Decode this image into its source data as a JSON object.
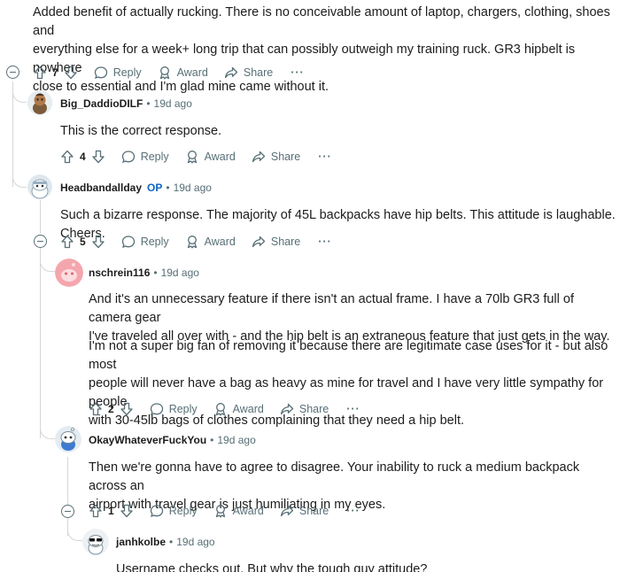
{
  "comments": [
    {
      "body": [
        "Added benefit of actually rucking. There is no conceivable amount of laptop, chargers, clothing, shoes and",
        "everything else for a week+ long trip that can possibly outweigh my training ruck. GR3 hipbelt is nowhere",
        "close to essential and I'm glad mine came without it."
      ],
      "votes": "7"
    },
    {
      "user": "Big_DaddioDILF",
      "time": "19d ago",
      "body": [
        "This is the correct response."
      ],
      "votes": "4"
    },
    {
      "user": "Headbandallday",
      "op": "OP",
      "time": "19d ago",
      "body": [
        "Such a bizarre response. The majority of 45L backpacks have hip belts. This attitude is laughable. Cheers."
      ],
      "votes": "5"
    },
    {
      "user": "nschrein116",
      "time": "19d ago",
      "body": [
        "And it's an unnecessary feature if there isn't an actual frame. I have a 70lb GR3 full of camera gear",
        "I've traveled all over with - and the hip belt is an extraneous feature that just gets in the way."
      ],
      "body2": [
        "I'm not a super big fan of removing it because there are legitimate case uses for it - but also most",
        "people will never have a bag as heavy as mine for travel and I have very little sympathy for people",
        "with 30-45lb bags of clothes complaining that they need a hip belt."
      ],
      "votes": "2"
    },
    {
      "user": "OkayWhateverFuckYou",
      "time": "19d ago",
      "body": [
        "Then we're gonna have to agree to disagree. Your inability to ruck a medium backpack across an",
        "airport with travel gear is just humiliating in my eyes."
      ],
      "votes": "1"
    },
    {
      "user": "janhkolbe",
      "time": "19d ago",
      "body": [
        "Username checks out. But why the tough guy attitude?"
      ]
    }
  ],
  "actions": {
    "reply": "Reply",
    "award": "Award",
    "share": "Share",
    "more": "···",
    "sep": "•"
  },
  "colors": {
    "op": "#0a65c2",
    "muted": "#576f76",
    "thread": "#d4d7d9"
  }
}
